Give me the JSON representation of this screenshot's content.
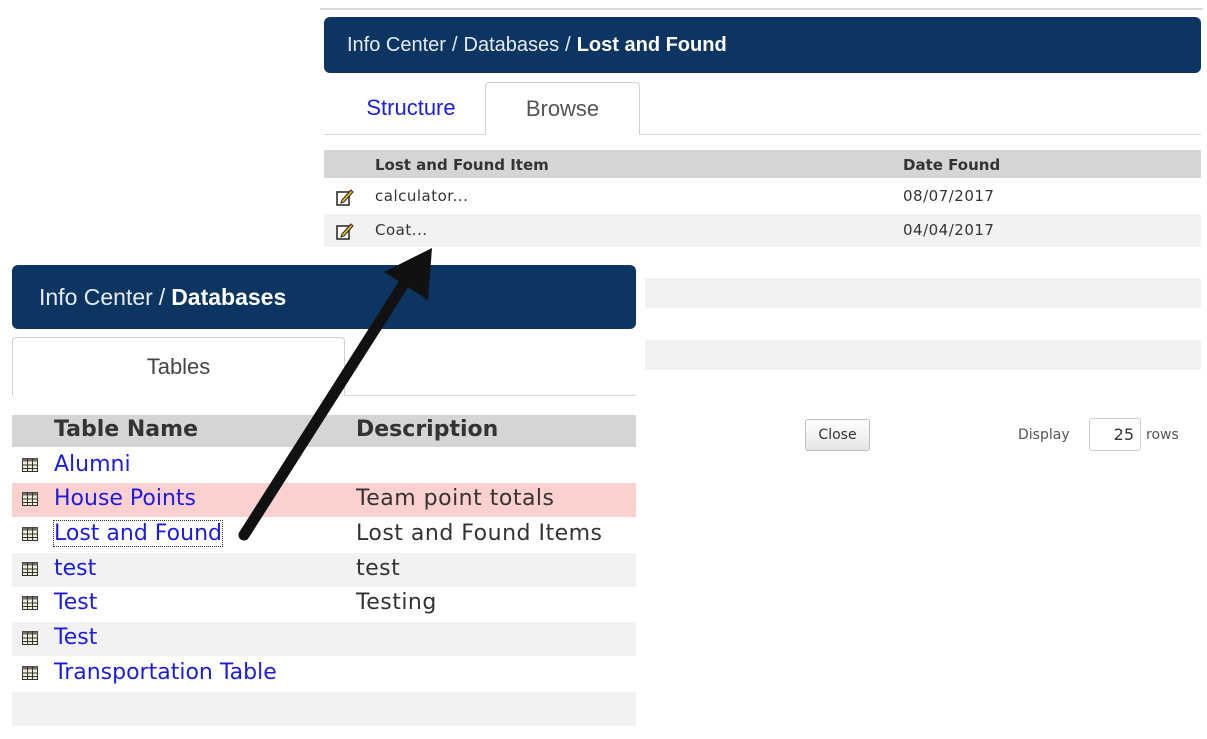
{
  "back_window": {
    "breadcrumb": {
      "crumb1": "Info Center",
      "crumb2": "Databases",
      "separator": "/",
      "current": "Lost and Found"
    },
    "tabs": [
      {
        "label": "Structure"
      },
      {
        "label": "Browse"
      }
    ],
    "grid": {
      "columns": [
        "Lost and Found Item",
        "Date Found"
      ],
      "rows": [
        {
          "item": "calculator...",
          "date": "08/07/2017"
        },
        {
          "item": "Coat...",
          "date": "04/04/2017"
        }
      ]
    },
    "close_label": "Close",
    "display_label": "Display",
    "rows_value": "25",
    "rows_label": "rows"
  },
  "front_window": {
    "breadcrumb": {
      "crumb1": "Info Center",
      "separator": "/",
      "current": "Databases"
    },
    "tab_label": "Tables",
    "table": {
      "columns": [
        "Table Name",
        "Description"
      ],
      "rows": [
        {
          "name": "Alumni",
          "description": ""
        },
        {
          "name": "House Points",
          "description": "Team point totals"
        },
        {
          "name": "Lost and Found",
          "description": "Lost and Found Items"
        },
        {
          "name": "test",
          "description": "test"
        },
        {
          "name": "Test",
          "description": "Testing"
        },
        {
          "name": "Test",
          "description": ""
        },
        {
          "name": "Transportation Table",
          "description": ""
        }
      ]
    }
  },
  "colors": {
    "header_bg": "#0d3562",
    "link": "#1c1ce0",
    "highlight_row": "#fdd0d0",
    "grid_header": "#d5d5d5"
  },
  "icons": {
    "edit": "pencil-edit-icon",
    "table": "table-grid-icon",
    "annotation": "arrow-pointer"
  }
}
